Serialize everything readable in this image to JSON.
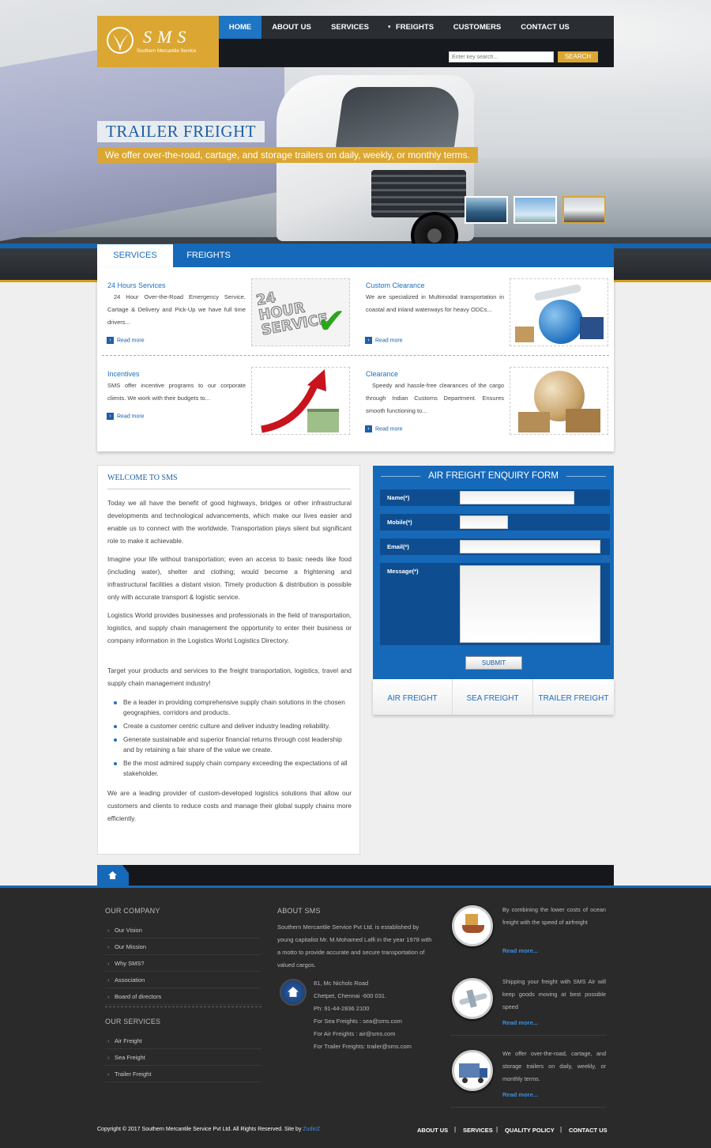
{
  "logo": {
    "name": "SMS",
    "tagline": "Southern Mercantile Service"
  },
  "nav": [
    {
      "label": "HOME"
    },
    {
      "label": "ABOUT US"
    },
    {
      "label": "SERVICES"
    },
    {
      "label": "FREIGHTS"
    },
    {
      "label": "CUSTOMERS"
    },
    {
      "label": "CONTACT US"
    }
  ],
  "search": {
    "placeholder": "Enter key search...",
    "button": "SEARCH"
  },
  "slide": {
    "title": "TRAILER FREIGHT",
    "subtitle": "We offer over-the-road, cartage, and storage trailers on daily, weekly, or monthly terms."
  },
  "tabs": {
    "services": "SERVICES",
    "freights": "FREIGHTS"
  },
  "services": [
    {
      "title": "24 Hours Services",
      "desc": "24 Hour Over-the-Road Emergency Service. Cartage & Delivery and Pick-Up we have full time drivers...",
      "more": "Read more",
      "img_text": "24 HOUR SERVICE"
    },
    {
      "title": "Custom Clearance",
      "desc": "We are specialized in Multimodal transportation in coastal and inland waterways for heavy ODCs...",
      "more": "Read more"
    },
    {
      "title": "Incentives",
      "desc": "SMS offer incentive programs to our corporate clients. We work with their budgets to...",
      "more": "Read more"
    },
    {
      "title": "Clearance",
      "desc": "Speedy and hassle-free clearances of the cargo through Indian Customs Department. Ensures smooth functioning to...",
      "more": "Read more"
    }
  ],
  "welcome": {
    "title": "WELCOME TO SMS",
    "p1": "Today we all have the benefit of good highways, bridges or other infrastructural developments and technological advancements, which make our lives easier and enable us to connect with the worldwide. Transportation plays silent but significant role to make it achievable.",
    "p2": "Imagine your life without transportation; even an access to basic needs like food (including water), shelter and clothing; would become a frightening and infrastructural facilities a distant vision. Timely production & distribution is possible only with accurate transport & logistic service.",
    "p3": "Logistics World provides businesses and professionals in the field of transportation, logistics, and supply chain management the opportunity to enter their business or company information in the Logistics World Logistics Directory.",
    "p4": "Target your products and services to the freight transportation, logistics, travel and supply chain management industry!",
    "bullets": [
      "Be a leader in providing comprehensive supply chain solutions in the chosen geographies, corridors and products.",
      "Create a customer centric culture and deliver industry leading reliability.",
      "Generate sustainable and superior financial returns through cost leadership and by retaining a fair share of the value we create.",
      "Be the most admired supply chain company exceeding the expectations of all stakeholder."
    ],
    "p5": "We are a leading provider of custom-developed logistics solutions that allow our customers and clients to reduce costs and manage their global supply chains more efficiently."
  },
  "form": {
    "title": "AIR FREIGHT ENQUIRY FORM",
    "name_label": "Name(*)",
    "mobile_label": "Mobile(*)",
    "email_label": "Email(*)",
    "message_label": "Message(*)",
    "submit": "SUBMIT",
    "tabs": [
      "AIR FREIGHT",
      "SEA FREIGHT",
      "TRAILER FREIGHT"
    ]
  },
  "footer": {
    "company_title": "OUR COMPANY",
    "company_links": [
      "Our Vision",
      "Our Mission",
      "Why SMS?",
      "Association",
      "Board of directors"
    ],
    "services_title": "OUR SERVICES",
    "services_links": [
      "Air Freight",
      "Sea Freight",
      "Trailer Freight"
    ],
    "about_title": "ABOUT SMS",
    "about_text": "Southern Mercantile Service Pvt Ltd. is established by young capitalist Mr. M.Mohamed Laffi in the year 1978 with a motto to provide accurate and secure transportation of valued cargos.",
    "address": [
      "81, Mc Nichols Road",
      "Chetpet, Chennai -600 031.",
      "Ph: 91-44-2836 2100",
      "For Sea Freights : sea@sms.com",
      "For Air Freights : air@sms.com",
      "For Trailer Freights: trailer@sms.com"
    ],
    "blurbs": [
      {
        "text": "By combining the lower costs of ocean freight with the speed of airfreight",
        "more": "Read more..."
      },
      {
        "text": "Shipping your freight with SMS Air will keep goods moving at best possible speed",
        "more": "Read more..."
      },
      {
        "text": "We offer over-the-road, cartage, and storage trailers on daily, weekly, or monthly terms.",
        "more": "Read more..."
      }
    ],
    "copyright": "Copyright © 2017 Southern Mercantile Service Pvt Ltd. All Rights Reserved. Site by",
    "credit": "ZudioZ",
    "bottom_links": [
      "ABOUT US",
      "SERVICES",
      "QUALITY POLICY",
      "CONTACT US"
    ]
  },
  "colors": {
    "brand_blue": "#1669b8",
    "gold": "#dba732",
    "nav_dark": "#2a2e33",
    "footer_bg": "#2a2a2a"
  }
}
